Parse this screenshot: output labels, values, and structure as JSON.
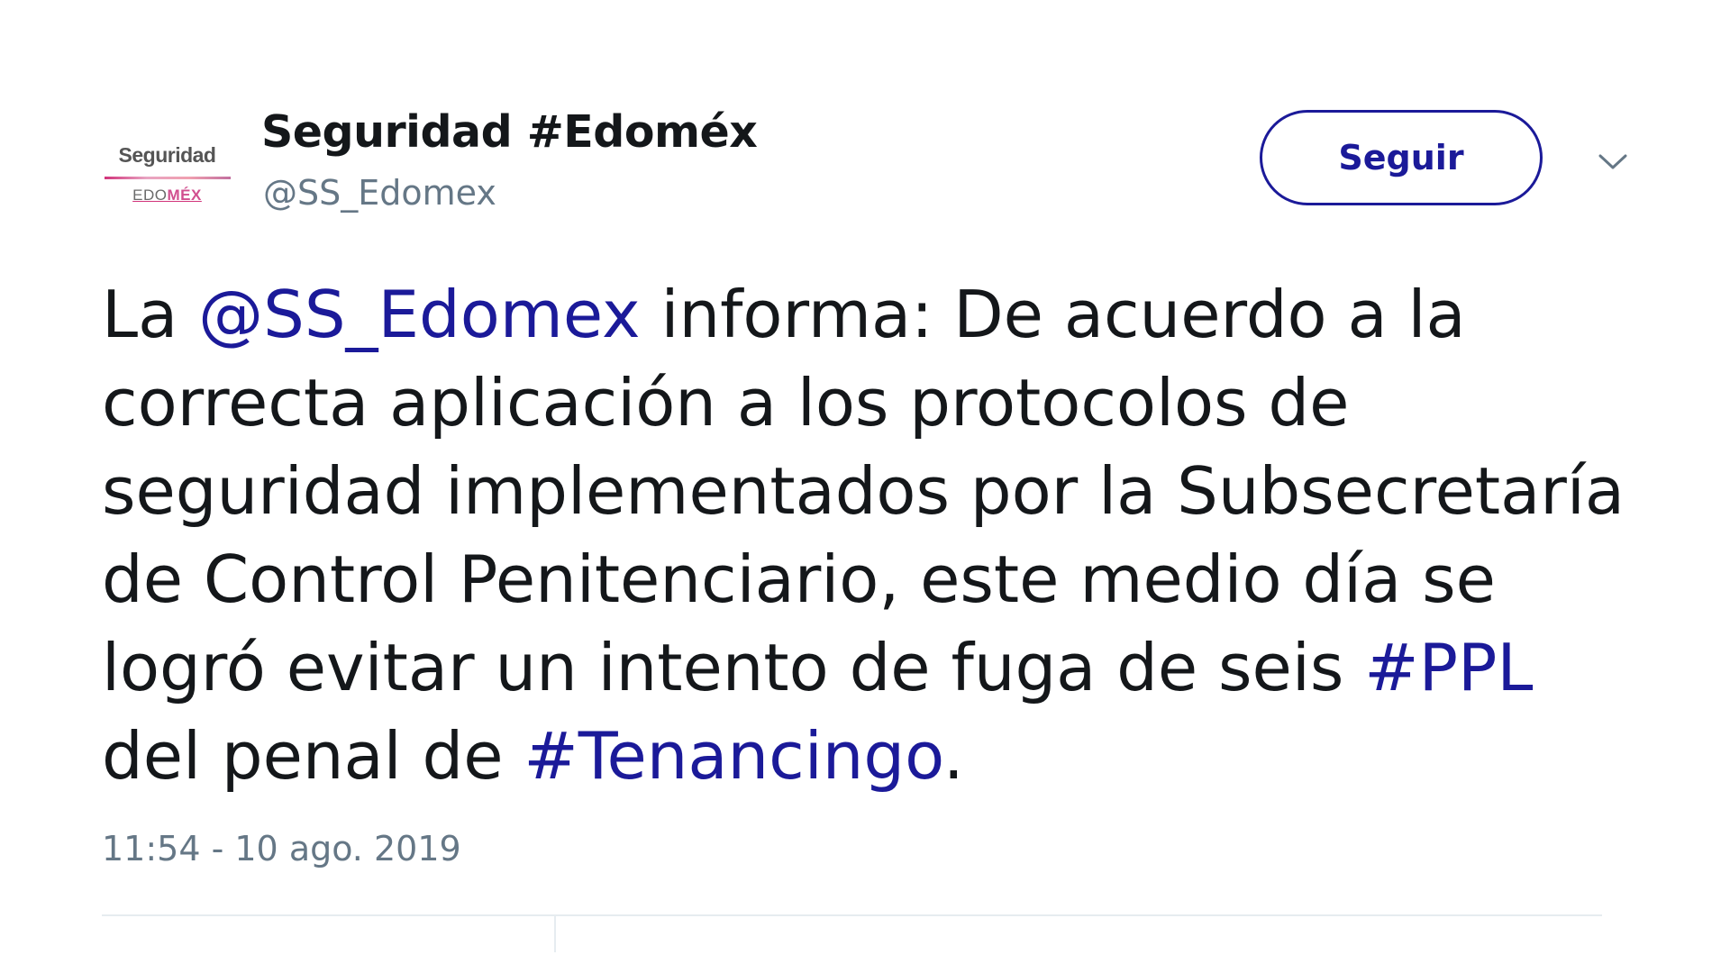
{
  "account": {
    "display_name": "Seguridad #Edoméx",
    "handle": "@SS_Edomex",
    "avatar": {
      "top_text": "Seguridad",
      "bottom_text_a": "EDO",
      "bottom_text_b": "MÉX"
    }
  },
  "actions": {
    "follow_label": "Seguir",
    "more_icon": "chevron-down-icon"
  },
  "tweet": {
    "segments": [
      {
        "text": "La ",
        "link": false
      },
      {
        "text": "@SS_Edomex",
        "link": true
      },
      {
        "text": " informa: De acuerdo a la correcta aplicación a los protocolos de seguridad implementados por la Subsecretaría de Control Penitenciario, este medio día se logró evitar un intento de fuga de seis ",
        "link": false
      },
      {
        "text": "#PPL",
        "link": true
      },
      {
        "text": " del penal de ",
        "link": false
      },
      {
        "text": "#Tenancingo",
        "link": true
      },
      {
        "text": ".",
        "link": false
      }
    ],
    "timestamp": "11:54 - 10 ago. 2019"
  },
  "colors": {
    "link": "#1b1a99",
    "text": "#14171a",
    "muted": "#657786",
    "divider": "#e6ecf0"
  }
}
